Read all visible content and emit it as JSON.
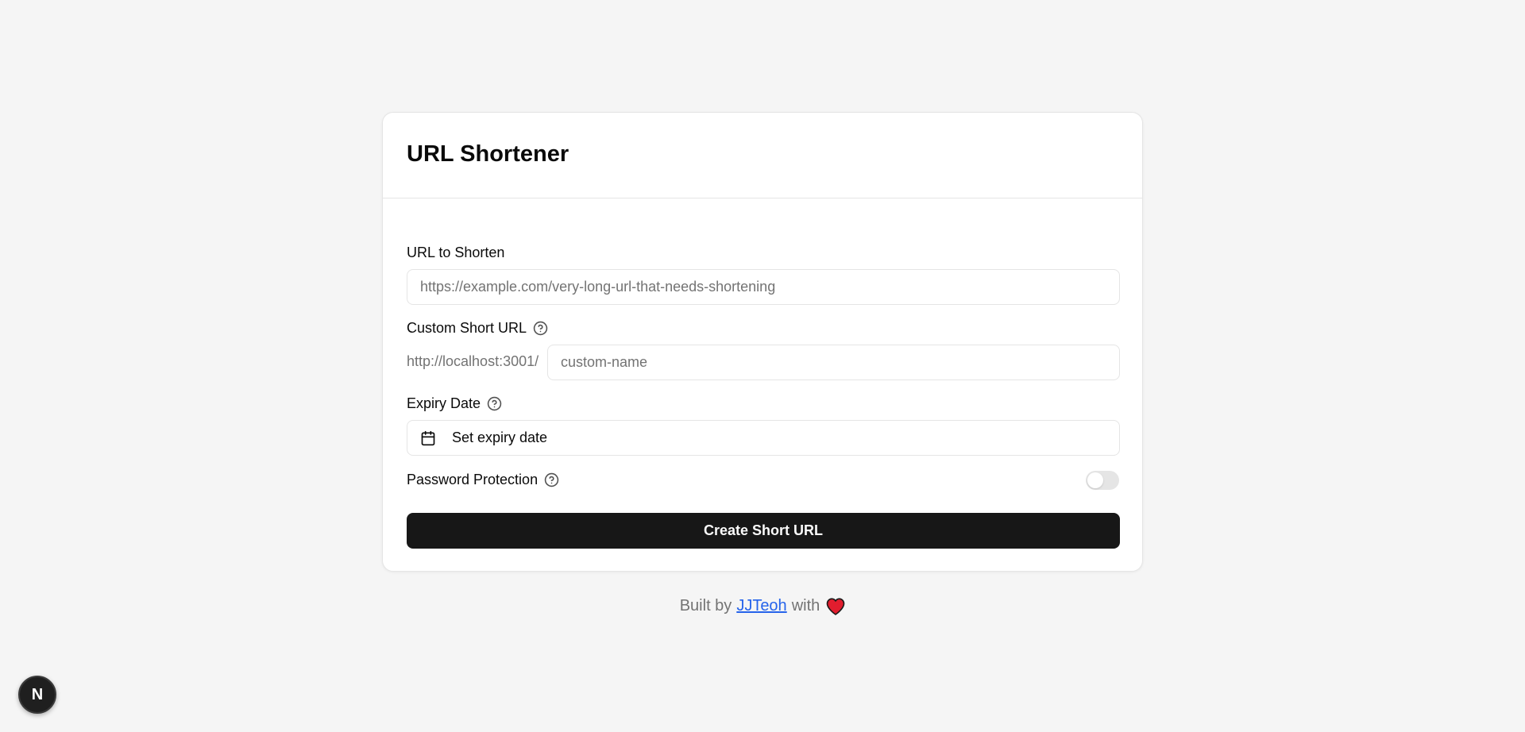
{
  "card": {
    "title": "URL Shortener"
  },
  "form": {
    "url_label": "URL to Shorten",
    "url_placeholder": "https://example.com/very-long-url-that-needs-shortening",
    "custom_label": "Custom Short URL",
    "custom_prefix": "http://localhost:3001/",
    "custom_placeholder": "custom-name",
    "expiry_label": "Expiry Date",
    "expiry_button": "Set expiry date",
    "password_label": "Password Protection",
    "password_enabled": false,
    "submit_label": "Create Short URL"
  },
  "footer": {
    "built_by": "Built by",
    "author": "JJTeoh",
    "with": "with"
  },
  "badge": {
    "letter": "N"
  },
  "icons": {
    "help": "help-circle-icon",
    "calendar": "calendar-icon",
    "heart": "heart-icon"
  },
  "colors": {
    "background": "#f5f5f5",
    "primary": "#171717",
    "link": "#2563eb",
    "heart": "#e11d2e"
  }
}
